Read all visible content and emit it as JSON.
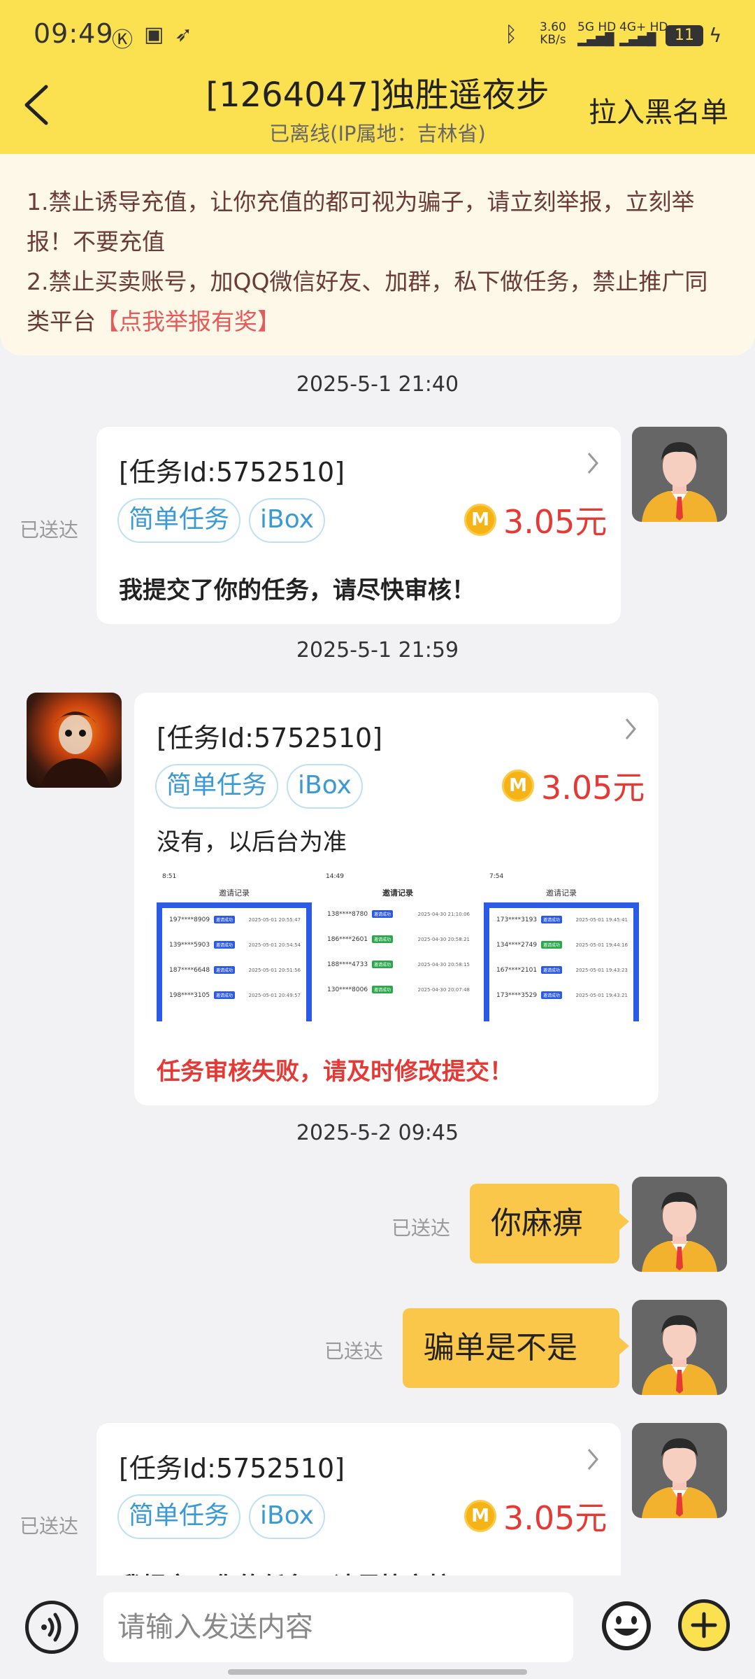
{
  "status_bar": {
    "time": "09:49",
    "net_speed": "3.60",
    "net_unit": "KB/s",
    "sig1": "5G HD",
    "sig2": "4G+ HD",
    "battery": "11"
  },
  "header": {
    "title": "[1264047]独胜遥夜步",
    "subtitle": "已离线(IP属地：吉林省)",
    "blacklist_label": "拉入黑名单"
  },
  "notice": {
    "line1": "1.禁止诱导充值，让你充值的都可视为骗子，请立刻举报，立刻举报！不要充值",
    "line2": "2.禁止买卖账号，加QQ微信好友、加群，私下做任务，禁止推广同类平台",
    "report_link": "【点我举报有奖】"
  },
  "messages": {
    "ts1": "2025-5-1 21:40",
    "card1": {
      "task_id": "[任务Id:5752510]",
      "tag1": "简单任务",
      "tag2": "iBox",
      "coin": "M",
      "price": "3.05元",
      "text": "我提交了你的任务，请尽快审核！",
      "status": "已送达"
    },
    "ts2": "2025-5-1 21:59",
    "card2": {
      "task_id": "[任务Id:5752510]",
      "tag1": "简单任务",
      "tag2": "iBox",
      "coin": "M",
      "price": "3.05元",
      "text": "没有，以后台为准",
      "fail_text": "任务审核失败，请及时修改提交！",
      "screenshots": [
        {
          "time": "8:51",
          "title": "邀请记录",
          "rows": [
            {
              "phone": "197****8909",
              "badge": "邀请成功",
              "date": "2025-05-01 20:55:47"
            },
            {
              "phone": "139****5903",
              "badge": "邀请成功",
              "date": "2025-05-01 20:54:54"
            },
            {
              "phone": "187****6648",
              "badge": "邀请成功",
              "date": "2025-05-01 20:51:56"
            },
            {
              "phone": "198****3105",
              "badge": "邀请成功",
              "date": "2025-05-01 20:49:57"
            }
          ]
        },
        {
          "time": "14:49",
          "title": "邀请记录",
          "rows": [
            {
              "phone": "138****8780",
              "badge": "邀请成功",
              "date": "2025-04-30 21:10:06"
            },
            {
              "phone": "186****2601",
              "badge": "邀请成功",
              "date": "2025-04-30 20:58:21"
            },
            {
              "phone": "188****4733",
              "badge": "邀请成功",
              "date": "2025-04-30 20:58:15"
            },
            {
              "phone": "130****8006",
              "badge": "邀请成功",
              "date": "2025-04-30 20:07:48"
            }
          ]
        },
        {
          "time": "7:54",
          "title": "邀请记录",
          "rows": [
            {
              "phone": "173****3193",
              "badge": "邀请成功",
              "date": "2025-05-01 19:45:41"
            },
            {
              "phone": "134****2749",
              "badge": "邀请成功",
              "date": "2025-05-01 19:44:16"
            },
            {
              "phone": "167****2101",
              "badge": "邀请成功",
              "date": "2025-05-01 19:43:23"
            },
            {
              "phone": "173****3529",
              "badge": "邀请成功",
              "date": "2025-05-01 19:43:21"
            }
          ]
        }
      ]
    },
    "ts3": "2025-5-2 09:45",
    "bubble1": {
      "text": "你麻痹",
      "status": "已送达"
    },
    "bubble2": {
      "text": "骗单是不是",
      "status": "已送达"
    },
    "card3": {
      "task_id": "[任务Id:5752510]",
      "tag1": "简单任务",
      "tag2": "iBox",
      "coin": "M",
      "price": "3.05元",
      "text": "我提交了你的任务，请尽快审核！",
      "status": "已送达"
    }
  },
  "composer": {
    "placeholder": "请输入发送内容"
  },
  "colors": {
    "header_bg": "#fbe04f",
    "bubble_bg": "#fbc74a",
    "price_red": "#e53935",
    "tag_blue": "#3b9ad4"
  }
}
